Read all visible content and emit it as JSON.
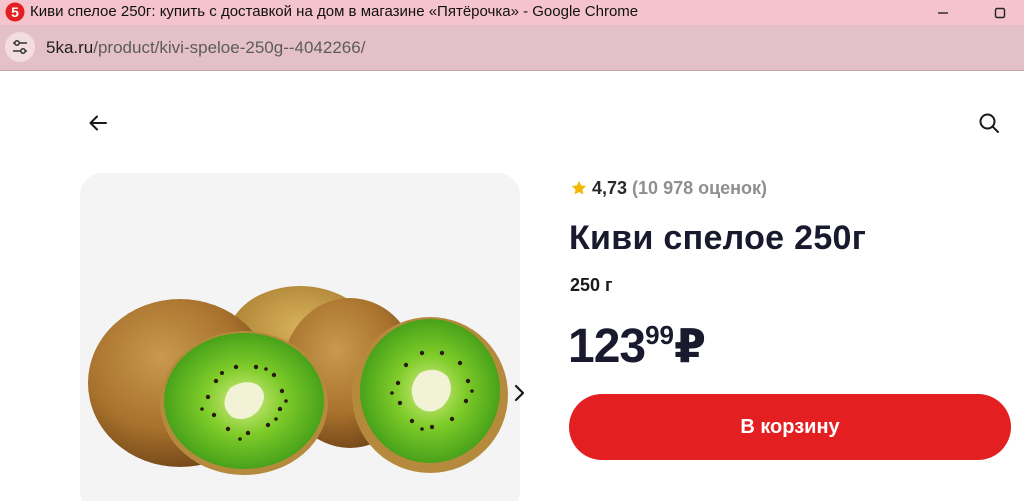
{
  "browser": {
    "window_title": "Киви спелое 250г: купить с доставкой на дом в магазине «Пятёрочка» - Google Chrome",
    "favicon_text": "5",
    "url_host": "5ka.ru",
    "url_path": "/product/kivi-speloe-250g--4042266/",
    "favicon_color": "#e31f22",
    "titlebar_color": "#f4c3cb"
  },
  "header": {
    "back_icon": "arrow-left-icon",
    "search_icon": "search-icon"
  },
  "gallery": {
    "image_description": "kiwi-fruit-photo",
    "next_icon": "chevron-right-icon"
  },
  "product": {
    "rating_icon": "star-icon",
    "rating_value": "4,73",
    "rating_count": "(10 978 оценок)",
    "title": "Киви спелое 250г",
    "weight": "250 г",
    "price_integer": "123",
    "price_cents": "99",
    "price_currency": "₽",
    "add_to_cart_label": "В корзину",
    "accent_color": "#e31f22",
    "star_color": "#f5b800"
  }
}
